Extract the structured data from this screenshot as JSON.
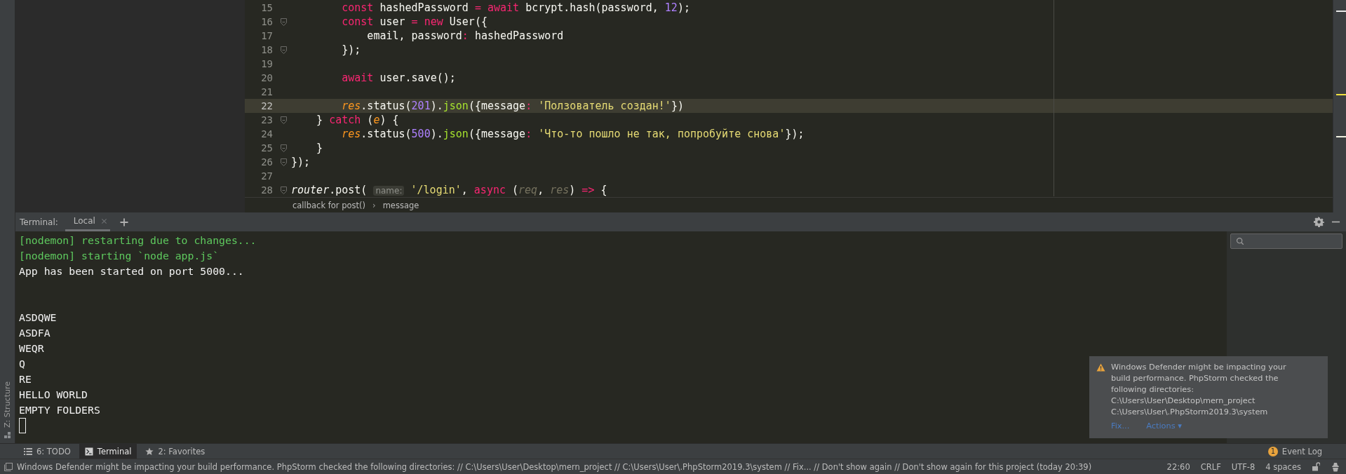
{
  "side_strip": {
    "label": "Z: Structure"
  },
  "editor": {
    "lines": [
      {
        "number": "15",
        "fold": false,
        "current": false,
        "tokens": [
          {
            "text": "        const",
            "kind": "keyword"
          },
          {
            "text": " hashedPassword ",
            "kind": "plain"
          },
          {
            "text": "=",
            "kind": "op"
          },
          {
            "text": " await",
            "kind": "keyword"
          },
          {
            "text": " bcrypt.hash(password, ",
            "kind": "plain"
          },
          {
            "text": "12",
            "kind": "number"
          },
          {
            "text": ");",
            "kind": "plain"
          }
        ]
      },
      {
        "number": "16",
        "fold": true,
        "current": false,
        "tokens": [
          {
            "text": "        const",
            "kind": "keyword"
          },
          {
            "text": " user ",
            "kind": "plain"
          },
          {
            "text": "=",
            "kind": "op"
          },
          {
            "text": " new",
            "kind": "keyword"
          },
          {
            "text": " User({",
            "kind": "plain"
          }
        ]
      },
      {
        "number": "17",
        "fold": false,
        "current": false,
        "tokens": [
          {
            "text": "            email, password",
            "kind": "plain"
          },
          {
            "text": ":",
            "kind": "op"
          },
          {
            "text": " hashedPassword",
            "kind": "plain"
          }
        ]
      },
      {
        "number": "18",
        "fold": true,
        "current": false,
        "tokens": [
          {
            "text": "        });",
            "kind": "plain"
          }
        ]
      },
      {
        "number": "19",
        "fold": false,
        "current": false
      },
      {
        "number": "20",
        "fold": false,
        "current": false,
        "tokens": [
          {
            "text": "        await",
            "kind": "keyword"
          },
          {
            "text": " user.save();",
            "kind": "plain"
          }
        ]
      },
      {
        "number": "21",
        "fold": false,
        "current": false
      },
      {
        "number": "22",
        "fold": false,
        "current": true,
        "tokens": [
          {
            "text": "        res",
            "kind": "param"
          },
          {
            "text": ".status(",
            "kind": "plain"
          },
          {
            "text": "201",
            "kind": "number"
          },
          {
            "text": ").",
            "kind": "plain"
          },
          {
            "text": "json",
            "kind": "function"
          },
          {
            "text": "({message",
            "kind": "plain"
          },
          {
            "text": ":",
            "kind": "op"
          },
          {
            "text": " 'Ползователь создан!'",
            "kind": "string"
          },
          {
            "text": "})",
            "kind": "plain"
          }
        ]
      },
      {
        "number": "23",
        "fold": true,
        "current": false,
        "tokens": [
          {
            "text": "    } ",
            "kind": "plain"
          },
          {
            "text": "catch",
            "kind": "keyword"
          },
          {
            "text": " (",
            "kind": "plain"
          },
          {
            "text": "e",
            "kind": "param"
          },
          {
            "text": ") {",
            "kind": "plain"
          }
        ]
      },
      {
        "number": "24",
        "fold": false,
        "current": false,
        "tokens": [
          {
            "text": "        res",
            "kind": "param"
          },
          {
            "text": ".status(",
            "kind": "plain"
          },
          {
            "text": "500",
            "kind": "number"
          },
          {
            "text": ").",
            "kind": "plain"
          },
          {
            "text": "json",
            "kind": "function"
          },
          {
            "text": "({message",
            "kind": "plain"
          },
          {
            "text": ":",
            "kind": "op"
          },
          {
            "text": " 'Что-то пошло не так, попробуйте снова'",
            "kind": "string"
          },
          {
            "text": "});",
            "kind": "plain"
          }
        ]
      },
      {
        "number": "25",
        "fold": true,
        "current": false,
        "tokens": [
          {
            "text": "    }",
            "kind": "plain"
          }
        ]
      },
      {
        "number": "26",
        "fold": true,
        "current": false,
        "tokens": [
          {
            "text": "});",
            "kind": "plain"
          }
        ]
      },
      {
        "number": "27",
        "fold": false,
        "current": false
      },
      {
        "number": "28",
        "fold": true,
        "current": false,
        "tokens": [
          {
            "text": "router",
            "kind": "global"
          },
          {
            "text": ".post( ",
            "kind": "plain"
          },
          {
            "text": "name:",
            "kind": "hint"
          },
          {
            "text": " '/login'",
            "kind": "string"
          },
          {
            "text": ", ",
            "kind": "plain"
          },
          {
            "text": "async",
            "kind": "keyword"
          },
          {
            "text": " (",
            "kind": "plain"
          },
          {
            "text": "req",
            "kind": "unused"
          },
          {
            "text": ", ",
            "kind": "plain"
          },
          {
            "text": "res",
            "kind": "unused"
          },
          {
            "text": ") ",
            "kind": "plain"
          },
          {
            "text": "=>",
            "kind": "op"
          },
          {
            "text": " {",
            "kind": "plain"
          }
        ]
      }
    ],
    "breadcrumbs": {
      "items": [
        "callback for post()",
        "message"
      ],
      "separator": "›"
    }
  },
  "terminal": {
    "label": "Terminal:",
    "tabs": [
      {
        "label": "Local",
        "selected": true
      }
    ],
    "blocks": [
      {
        "lines": [
          {
            "text": "[nodemon] restarting due to changes...",
            "kind": "nodemon"
          },
          {
            "text": "[nodemon] starting `node app.js`",
            "kind": "nodemon"
          },
          {
            "text": "App has been started on port 5000...",
            "kind": "output"
          }
        ]
      },
      {
        "lines": [
          {
            "text": "ASDQWE",
            "kind": "output"
          },
          {
            "text": "ASDFA",
            "kind": "output"
          },
          {
            "text": "WEQR",
            "kind": "output"
          },
          {
            "text": "Q",
            "kind": "output"
          },
          {
            "text": "RE",
            "kind": "output"
          },
          {
            "text": "HELLO WORLD",
            "kind": "output"
          },
          {
            "text": "EMPTY FOLDERS",
            "kind": "output"
          }
        ]
      }
    ]
  },
  "notification": {
    "text": "Windows Defender might be impacting your build performance. PhpStorm checked the following directories:",
    "paths": [
      "C:\\Users\\User\\Desktop\\mern_project",
      "C:\\Users\\User\\.PhpStorm2019.3\\system"
    ],
    "actions": [
      "Fix...",
      "Actions ▾"
    ]
  },
  "tool_window_bar": {
    "items": [
      {
        "label": "6: TODO",
        "kind": "todo",
        "selected": false
      },
      {
        "label": "Terminal",
        "kind": "terminal",
        "selected": true
      },
      {
        "label": "2: Favorites",
        "kind": "favorites",
        "selected": false
      }
    ],
    "event_log": {
      "label": "Event Log",
      "count": "1"
    }
  },
  "status_bar": {
    "message": "Windows Defender might be impacting your build performance. PhpStorm checked the following directories: // C:\\Users\\User\\Desktop\\mern_project // C:\\Users\\User\\.PhpStorm2019.3\\system // Fix... // Don't show again // Don't show again for this project (today 20:39)",
    "items": [
      "22:60",
      "CRLF",
      "UTF-8",
      "4 spaces"
    ]
  }
}
